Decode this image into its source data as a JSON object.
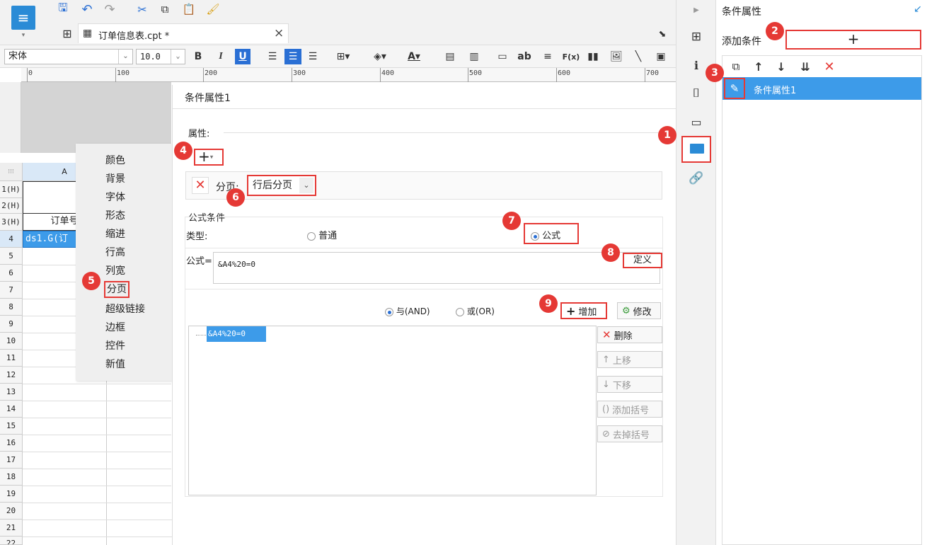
{
  "tab": {
    "title": "订单信息表.cpt *",
    "close": "×"
  },
  "format_bar": {
    "font": "宋体",
    "size": "10.0",
    "bold": "B",
    "italic": "I",
    "underline": "U",
    "text_tool": "ab",
    "formula_tool": "F(x)"
  },
  "ruler": {
    "ticks": [
      "0",
      "100",
      "200",
      "300",
      "400",
      "500",
      "600",
      "700"
    ]
  },
  "sheet": {
    "col_a": "A",
    "row_labels": [
      "1(H)",
      "2(H)",
      "3(H)",
      "4",
      "5",
      "6",
      "7",
      "8",
      "9",
      "10",
      "11",
      "12",
      "13",
      "14",
      "15",
      "16",
      "17",
      "18",
      "19",
      "20",
      "21",
      "22"
    ],
    "cell_a3": "订单号",
    "cell_a4": "ds1.G(订"
  },
  "context_menu": {
    "items": [
      "颜色",
      "背景",
      "字体",
      "形态",
      "缩进",
      "行高",
      "列宽",
      "分页",
      "超级链接",
      "边框",
      "控件",
      "新值"
    ]
  },
  "dialog": {
    "title": "条件属性1",
    "attr_label": "属性:",
    "pagebreak_label": "分页:",
    "pagebreak_value": "行后分页",
    "formula_section": "公式条件",
    "type_label": "类型:",
    "type_normal": "普通",
    "type_formula": "公式",
    "formula_label": "公式=",
    "formula_value": "&A4%20=0",
    "define_button": "定义",
    "and_label": "与(AND)",
    "or_label": "或(OR)",
    "add_button": "增加",
    "modify_button": "修改",
    "delete_button": "删除",
    "up_button": "上移",
    "down_button": "下移",
    "add_bracket_button": "添加括号",
    "remove_bracket_button": "去掉括号",
    "condition_item": "&A4%20=0"
  },
  "right_panel": {
    "title": "条件属性",
    "add_condition_label": "添加条件",
    "add_button": "+",
    "list_item": "条件属性1"
  },
  "badges": [
    "1",
    "2",
    "3",
    "4",
    "5",
    "6",
    "7",
    "8",
    "9"
  ],
  "colors": {
    "accent": "#2a8bd6",
    "highlight": "#3d9be9",
    "annotation": "#e53935",
    "delete": "#e53935"
  }
}
